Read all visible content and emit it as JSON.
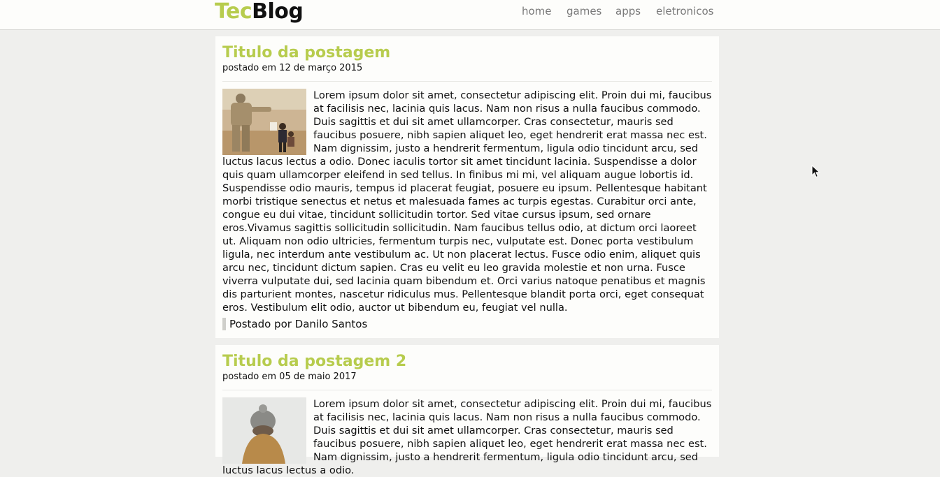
{
  "header": {
    "logo_part1": "Tec",
    "logo_part2": "Blog",
    "nav": [
      "home",
      "games",
      "apps",
      "eletronicos"
    ]
  },
  "posts": [
    {
      "title": "Titulo da postagem",
      "date": "postado em 12 de março 2015",
      "image": "soldier-with-child-photo",
      "body": "Lorem ipsum dolor sit amet, consectetur adipiscing elit. Proin dui mi, faucibus at facilisis nec, lacinia quis lacus. Nam non risus a nulla faucibus commodo. Duis sagittis et dui sit amet ullamcorper. Cras consectetur, mauris sed faucibus posuere, nibh sapien aliquet leo, eget hendrerit erat massa nec est. Nam dignissim, justo a hendrerit fermentum, ligula odio tincidunt arcu, sed luctus lacus lectus a odio. Donec iaculis tortor sit amet tincidunt lacinia. Suspendisse a dolor quis quam ullamcorper eleifend in sed tellus. In finibus mi mi, vel aliquam augue lobortis id. Suspendisse odio mauris, tempus id placerat feugiat, posuere eu ipsum. Pellentesque habitant morbi tristique senectus et netus et malesuada fames ac turpis egestas. Curabitur orci ante, congue eu dui vitae, tincidunt sollicitudin tortor. Sed vitae cursus ipsum, sed ornare eros.Vivamus sagittis sollicitudin sollicitudin. Nam faucibus tellus odio, at dictum orci laoreet ut. Aliquam non odio ultricies, fermentum turpis nec, vulputate est. Donec porta vestibulum ligula, nec interdum ante vestibulum ac. Ut non placerat lectus. Fusce odio enim, aliquet quis arcu nec, tincidunt dictum sapien. Cras eu velit eu leo gravida molestie et non urna. Fusce viverra vulputate dui, sed lacinia quam bibendum et. Orci varius natoque penatibus et magnis dis parturient montes, nascetur ridiculus mus. Pellentesque blandit porta orci, eget consequat eros. Vestibulum elit odio, auctor ut bibendum eu, feugiat vel nulla.",
      "author": "Postado por Danilo Santos"
    },
    {
      "title": "Titulo da postagem 2",
      "date": "postado em 05 de maio 2017",
      "image": "person-with-knit-hat-photo",
      "body": "Lorem ipsum dolor sit amet, consectetur adipiscing elit. Proin dui mi, faucibus at facilisis nec, lacinia quis lacus. Nam non risus a nulla faucibus commodo. Duis sagittis et dui sit amet ullamcorper. Cras consectetur, mauris sed faucibus posuere, nibh sapien aliquet leo, eget hendrerit erat massa nec est. Nam dignissim, justo a hendrerit fermentum, ligula odio tincidunt arcu, sed luctus lacus lectus a odio."
    }
  ],
  "colors": {
    "accent": "#b7cc4e",
    "background": "#efefed",
    "card": "#fdfdfb"
  }
}
